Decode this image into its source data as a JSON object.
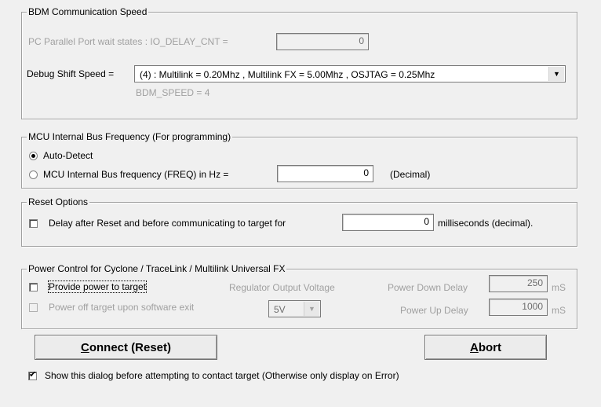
{
  "bdm": {
    "legend": "BDM Communication Speed",
    "parallel_label": "PC Parallel Port wait states : IO_DELAY_CNT =",
    "parallel_value": "0",
    "shift_label": "Debug Shift Speed =",
    "shift_value": "(4)  :  Multilink = 0.20Mhz  ,  Multilink FX =  5.00Mhz  ,  OSJTAG = 0.25Mhz",
    "bdm_speed": "BDM_SPEED = 4"
  },
  "mcu": {
    "legend": "MCU Internal Bus Frequency (For programming)",
    "auto_detect_label": "Auto-Detect",
    "freq_label": "MCU Internal Bus frequency (FREQ) in Hz =",
    "freq_value": "0",
    "freq_unit": "(Decimal)"
  },
  "reset": {
    "legend": "Reset Options",
    "delay_label": "Delay after Reset and before communicating to target for",
    "delay_value": "0",
    "delay_unit": "milliseconds (decimal)."
  },
  "power": {
    "legend": "Power Control for Cyclone / TraceLink / Multilink Universal FX",
    "provide_label": "Provide power to target",
    "power_off_label": "Power off target upon software exit",
    "regulator_label": "Regulator Output Voltage",
    "voltage_value": "5V",
    "power_down_label": "Power Down Delay",
    "power_down_value": "250",
    "power_up_label": "Power Up Delay",
    "power_up_value": "1000",
    "ms_unit": "mS"
  },
  "buttons": {
    "connect_mnemonic": "C",
    "connect_rest": "onnect (Reset)",
    "abort_mnemonic": "A",
    "abort_rest": "bort"
  },
  "footer": {
    "show_dialog_label": "Show this dialog before attempting to contact target (Otherwise only display on Error)"
  }
}
